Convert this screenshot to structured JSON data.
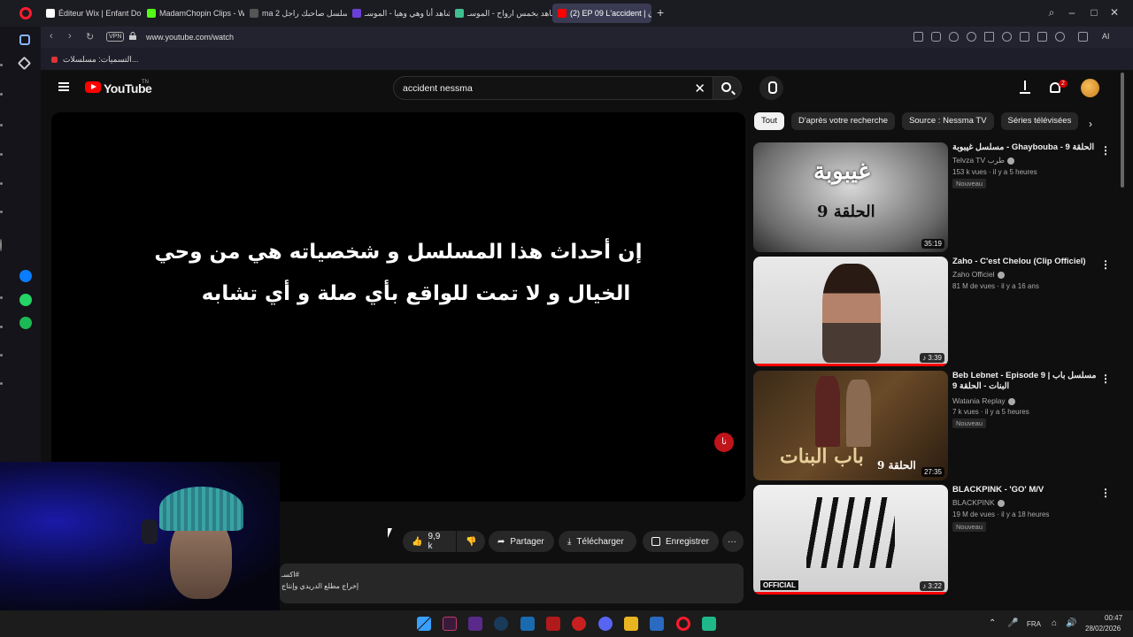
{
  "browser": {
    "tabs": [
      {
        "label": "Éditeur Wix | Enfant Dou 1",
        "color": "#ffffff"
      },
      {
        "label": "MadamChopin Clips - Wa",
        "color": "#53fc18"
      },
      {
        "label": "ma 2 مسلسل صاحبك راجل",
        "color": "#555555"
      },
      {
        "label": "شاهد أنا وهي وهيا - الموسـ",
        "color": "#6b3fd6"
      },
      {
        "label": "شاهد بخمس ارواح - الموسـ",
        "color": "#3fbf8f"
      },
      {
        "label": "(2) EP 09 L'accident | تدون",
        "color": "#ff0000"
      }
    ],
    "new_tab_label": "+",
    "url": "www.youtube.com/watch",
    "vpn_label": "VPN",
    "bookmark": "التسميات: مسلسلات...",
    "ai_label": "AI"
  },
  "youtube": {
    "logo_text": "YouTube",
    "logo_tm": "TN",
    "search_query": "accident nessma",
    "notification_count": "2"
  },
  "player": {
    "subtitle_line1": "إن أحداث هذا المسلسل و شخصياته هي من وحي",
    "subtitle_line2": "الخيال و لا تمت للواقع بأي صلة و أي تشابه",
    "channel_mark": "نا"
  },
  "actions": {
    "likes": "9,9 k",
    "share": "Partager",
    "download": "Télécharger",
    "save": "Enregistrer",
    "more": "···"
  },
  "description": {
    "line1": "#اكسـ",
    "line2": "إخراج مطلع الدريدي وإنتاج"
  },
  "chips": [
    "Tout",
    "D'après votre recherche",
    "Source : Nessma TV",
    "Séries télévisées"
  ],
  "recommendations": [
    {
      "title": "مسلسل غيبوبة - Ghaybouba - الحلقة 9",
      "channel": "Telvza TV طرب",
      "meta": "153 k vues · il y a 5 heures",
      "badge": "Nouveau",
      "duration": "35:19",
      "thumb_text1": "غيبوبة",
      "thumb_text2": "الحلقة 9",
      "progress": 0
    },
    {
      "title": "Zaho - C'est Chelou (Clip Officiel)",
      "channel": "Zaho Officiel",
      "meta": "81 M de vues · il y a 16 ans",
      "badge": "",
      "duration": "♪ 3:39",
      "thumb_text1": "",
      "thumb_text2": "",
      "progress": 1
    },
    {
      "title": "Beb Lebnet - Episode 9 | مسلسل باب البنات - الحلقة 9",
      "channel": "Watania Replay",
      "meta": "7 k vues · il y a 5 heures",
      "badge": "Nouveau",
      "duration": "27:35",
      "thumb_text1": "باب البنات",
      "thumb_text2": "الحلقة 9",
      "progress": 0
    },
    {
      "title": "BLACKPINK - 'GO' M/V",
      "channel": "BLACKPINK",
      "meta": "19 M de vues · il y a 18 heures",
      "badge": "Nouveau",
      "duration": "♪ 3:22",
      "thumb_text1": "OFFICIAL",
      "thumb_text2": "",
      "progress": 1
    }
  ],
  "taskbar": {
    "lang": "FRA",
    "time": "00:47",
    "date": "28/02/2026"
  }
}
